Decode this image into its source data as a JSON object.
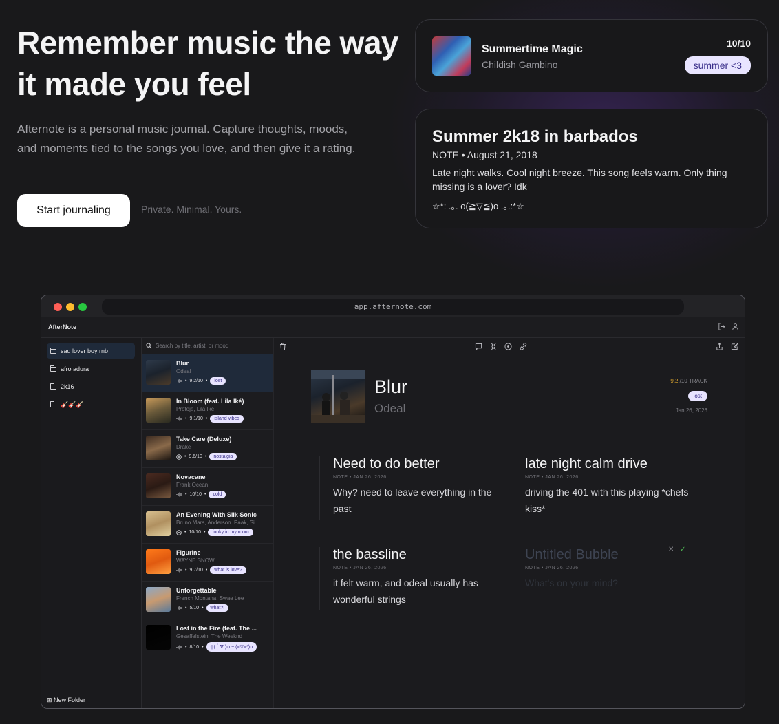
{
  "hero": {
    "title": "Remember music the way it made you feel",
    "subtitle": "Afternote is a personal music journal. Capture thoughts, moods, and moments tied to the songs you love, and then give it a rating.",
    "cta_label": "Start journaling",
    "tagline": "Private. Minimal. Yours."
  },
  "song_card": {
    "title": "Summertime Magic",
    "artist": "Childish Gambino",
    "score": "10/10",
    "tag": "summer <3"
  },
  "note_card": {
    "title": "Summer 2k18 in barbados",
    "meta": "NOTE • August 21, 2018",
    "body": "Late night walks. Cool night breeze. This song feels warm. Only thing missing is a lover? Idk",
    "kaomoji": "☆*: .｡. o(≧▽≦)o .｡.:*☆"
  },
  "window": {
    "url": "app.afternote.com",
    "app_name": "AfterNote",
    "search_placeholder": "Search by title, artist, or mood",
    "new_folder": "⊞ New Folder",
    "folders": [
      "sad lover boy rnb",
      "afro adura",
      "2k16",
      "🎸🎸🎸"
    ],
    "songs": [
      {
        "title": "Blur",
        "artist": "Odeal",
        "icon": "waveform",
        "score": "9.2/10",
        "tag": "lost"
      },
      {
        "title": "In Bloom (feat. Lila Iké)",
        "artist": "Protoje, Lila Iké",
        "icon": "waveform",
        "score": "9.1/10",
        "tag": "island vibes"
      },
      {
        "title": "Take Care (Deluxe)",
        "artist": "Drake",
        "icon": "disc",
        "score": "9.6/10",
        "tag": "nostalgia"
      },
      {
        "title": "Novacane",
        "artist": "Frank Ocean",
        "icon": "waveform",
        "score": "10/10",
        "tag": "cold"
      },
      {
        "title": "An Evening With Silk Sonic",
        "artist": "Bruno Mars, Anderson .Paak, Si...",
        "icon": "disc",
        "score": "10/10",
        "tag": "funky in my room"
      },
      {
        "title": "Figurine",
        "artist": "WAYNE SNOW",
        "icon": "waveform",
        "score": "9.7/10",
        "tag": "what is love?"
      },
      {
        "title": "Unforgettable",
        "artist": "French Montana, Swae Lee",
        "icon": "waveform",
        "score": "5/10",
        "tag": "what?!"
      },
      {
        "title": "Lost in the Fire (feat. The ...",
        "artist": "Gesaffelstein, The Weeknd",
        "icon": "waveform",
        "score": "8/10",
        "tag": "ψ(｀∇´)ψ ~ (≡▽≡*)o"
      }
    ],
    "detail": {
      "title": "Blur",
      "artist": "Odeal",
      "rating_value": "9.2",
      "rating_suffix": " /10 TRACK",
      "tag": "lost",
      "date": "Jan 26, 2026",
      "bubbles": [
        {
          "title": "Need to do better",
          "meta": "NOTE • JAN 26, 2026",
          "body": "Why? need to leave everything in the past"
        },
        {
          "title": "late night calm drive",
          "meta": "NOTE • JAN 26, 2026",
          "body": "driving the 401 with this playing *chefs kiss*"
        },
        {
          "title": "the bassline",
          "meta": "NOTE • JAN 26, 2026",
          "body": "it felt warm, and odeal usually has wonderful strings"
        },
        {
          "title": "Untitled Bubble",
          "meta": "NOTE • JAN 26, 2026",
          "body": "What's on your mind?"
        }
      ]
    }
  },
  "colors": {
    "accent_rating": "#e0a82e",
    "tag_bg": "#e8e4ff",
    "tag_fg": "#3a2f8a",
    "active_row": "#1f2a3a"
  }
}
